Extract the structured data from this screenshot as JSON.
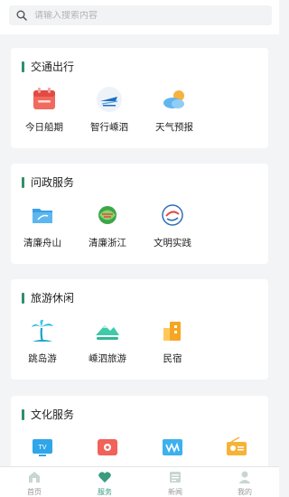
{
  "search": {
    "placeholder": "请输入搜索内容"
  },
  "sections": [
    {
      "title": "交通出行",
      "items": [
        {
          "label": "今日船期",
          "icon": "calendar-icon"
        },
        {
          "label": "智行嵊泗",
          "icon": "ship-logo-icon"
        },
        {
          "label": "天气预报",
          "icon": "weather-icon"
        }
      ]
    },
    {
      "title": "问政服务",
      "items": [
        {
          "label": "清廉舟山",
          "icon": "folder-icon"
        },
        {
          "label": "清廉浙江",
          "icon": "qinglian-logo-icon"
        },
        {
          "label": "文明实践",
          "icon": "civilization-logo-icon"
        }
      ]
    },
    {
      "title": "旅游休闲",
      "items": [
        {
          "label": "跳岛游",
          "icon": "palm-tree-icon"
        },
        {
          "label": "嵊泗旅游",
          "icon": "mountain-icon"
        },
        {
          "label": "民宿",
          "icon": "building-icon"
        }
      ]
    },
    {
      "title": "文化服务",
      "items": [
        {
          "label": "",
          "icon": "tv-icon"
        },
        {
          "label": "",
          "icon": "flower-calendar-icon"
        },
        {
          "label": "",
          "icon": "wave-screen-icon"
        },
        {
          "label": "",
          "icon": "radio-icon"
        }
      ]
    }
  ],
  "tabbar": [
    {
      "label": "首页",
      "icon": "home-icon",
      "active": false
    },
    {
      "label": "服务",
      "icon": "heart-icon",
      "active": true
    },
    {
      "label": "新闻",
      "icon": "news-icon",
      "active": false
    },
    {
      "label": "我的",
      "icon": "user-icon",
      "active": false
    }
  ],
  "colors": {
    "accent": "#2f8f6b",
    "active_tab": "#3a9b7e"
  }
}
